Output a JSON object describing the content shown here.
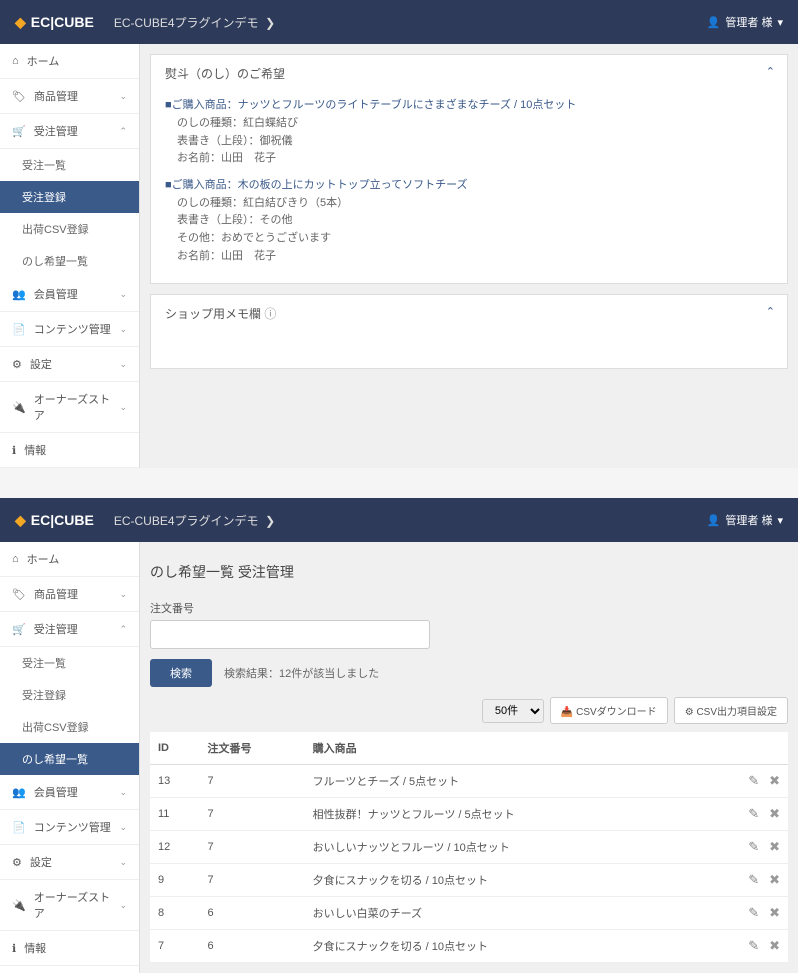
{
  "brand": "EC|CUBE",
  "breadcrumb": "EC-CUBE4プラグインデモ",
  "user": "管理者 様",
  "nav1": {
    "home": "ホーム",
    "products": "商品管理",
    "orders": "受注管理",
    "sub_order_list": "受注一覧",
    "sub_order_reg": "受注登録",
    "sub_ship_csv": "出荷CSV登録",
    "sub_noshi_list": "のし希望一覧",
    "members": "会員管理",
    "contents": "コンテンツ管理",
    "settings": "設定",
    "owners": "オーナーズストア",
    "info": "情報"
  },
  "noshi": {
    "title": "熨斗（のし）のご希望",
    "block1": {
      "title": "■ご購入商品：ナッツとフルーツのライトテーブルにさまざまなチーズ / 10点セット",
      "l1": "のしの種類：紅白蝶結び",
      "l2": "表書き（上段）：御祝儀",
      "l3": "お名前：山田　花子"
    },
    "block2": {
      "title": "■ご購入商品：木の板の上にカットトップ立ってソフトチーズ",
      "l1": "のしの種類：紅白結びきり（5本）",
      "l2": "表書き（上段）：その他",
      "l3": "その他：おめでとうございます",
      "l4": "お名前：山田　花子"
    }
  },
  "memo": "ショップ用メモ欄",
  "page2": {
    "title": "のし希望一覧 受注管理",
    "searchLabel": "注文番号",
    "searchBtn": "検索",
    "result": "検索結果：12件が該当しました",
    "perPage": "50件",
    "csv": "CSVダウンロード",
    "csvSet": "CSV出力項目設定",
    "cols": {
      "id": "ID",
      "orderNo": "注文番号",
      "product": "購入商品"
    },
    "rows": [
      {
        "id": "13",
        "no": "7",
        "product": "フルーツとチーズ / 5点セット"
      },
      {
        "id": "11",
        "no": "7",
        "product": "相性抜群！ナッツとフルーツ / 5点セット"
      },
      {
        "id": "12",
        "no": "7",
        "product": "おいしいナッツとフルーツ / 10点セット"
      },
      {
        "id": "9",
        "no": "7",
        "product": "夕食にスナックを切る / 10点セット"
      },
      {
        "id": "8",
        "no": "6",
        "product": "おいしい白菜のチーズ"
      },
      {
        "id": "7",
        "no": "6",
        "product": "夕食にスナックを切る / 10点セット"
      }
    ]
  }
}
